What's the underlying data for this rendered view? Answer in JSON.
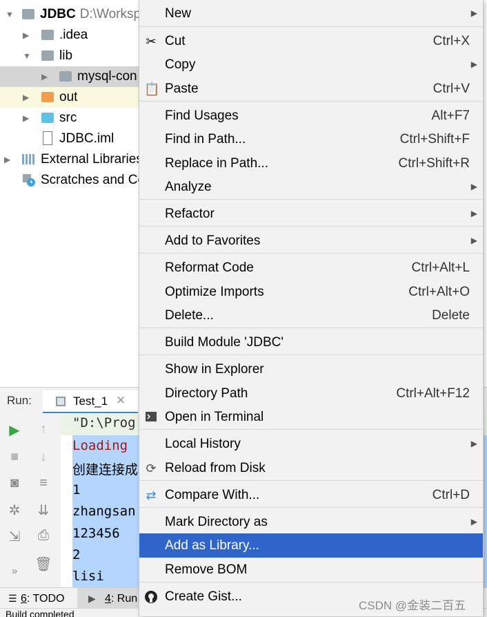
{
  "tree": {
    "root": {
      "name": "JDBC",
      "path": "D:\\Worksp"
    },
    "items": [
      {
        "label": ".idea"
      },
      {
        "label": "lib"
      },
      {
        "label": "mysql-con"
      },
      {
        "label": "out"
      },
      {
        "label": "src"
      },
      {
        "label": "JDBC.iml"
      },
      {
        "label": "External Libraries"
      },
      {
        "label": "Scratches and Co"
      }
    ]
  },
  "run": {
    "title": "Run:",
    "tab": "Test_1",
    "console": [
      "\"D:\\Prog",
      "Loading",
      "创建连接成",
      "1",
      "zhangsan",
      "123456",
      "2",
      "lisi"
    ]
  },
  "bottom_tabs": [
    {
      "num": "6",
      "label": ": TODO"
    },
    {
      "num": "4",
      "label": ": Run"
    }
  ],
  "status_text": "Build completed",
  "menu": {
    "items": [
      {
        "label": "New",
        "shortcut": "",
        "submenu": true
      },
      {
        "label": "Cut",
        "shortcut": "Ctrl+X"
      },
      {
        "label": "Copy",
        "shortcut": "",
        "submenu": true
      },
      {
        "label": "Paste",
        "shortcut": "Ctrl+V"
      },
      {
        "label": "Find Usages",
        "shortcut": "Alt+F7"
      },
      {
        "label": "Find in Path...",
        "shortcut": "Ctrl+Shift+F"
      },
      {
        "label": "Replace in Path...",
        "shortcut": "Ctrl+Shift+R"
      },
      {
        "label": "Analyze",
        "shortcut": "",
        "submenu": true
      },
      {
        "label": "Refactor",
        "shortcut": "",
        "submenu": true
      },
      {
        "label": "Add to Favorites",
        "shortcut": "",
        "submenu": true
      },
      {
        "label": "Reformat Code",
        "shortcut": "Ctrl+Alt+L"
      },
      {
        "label": "Optimize Imports",
        "shortcut": "Ctrl+Alt+O"
      },
      {
        "label": "Delete...",
        "shortcut": "Delete"
      },
      {
        "label": "Build Module 'JDBC'",
        "shortcut": ""
      },
      {
        "label": "Show in Explorer",
        "shortcut": ""
      },
      {
        "label": "Directory Path",
        "shortcut": "Ctrl+Alt+F12"
      },
      {
        "label": "Open in Terminal",
        "shortcut": ""
      },
      {
        "label": "Local History",
        "shortcut": "",
        "submenu": true
      },
      {
        "label": "Reload from Disk",
        "shortcut": ""
      },
      {
        "label": "Compare With...",
        "shortcut": "Ctrl+D"
      },
      {
        "label": "Mark Directory as",
        "shortcut": "",
        "submenu": true
      },
      {
        "label": "Add as Library...",
        "shortcut": "",
        "active": true
      },
      {
        "label": "Remove BOM",
        "shortcut": ""
      },
      {
        "label": "Create Gist...",
        "shortcut": ""
      }
    ]
  },
  "watermark": "CSDN @金装二百五",
  "colors": {
    "menu_highlight": "#2f65ca",
    "console_selection": "#b4d5fe",
    "console_error": "#a31515"
  }
}
